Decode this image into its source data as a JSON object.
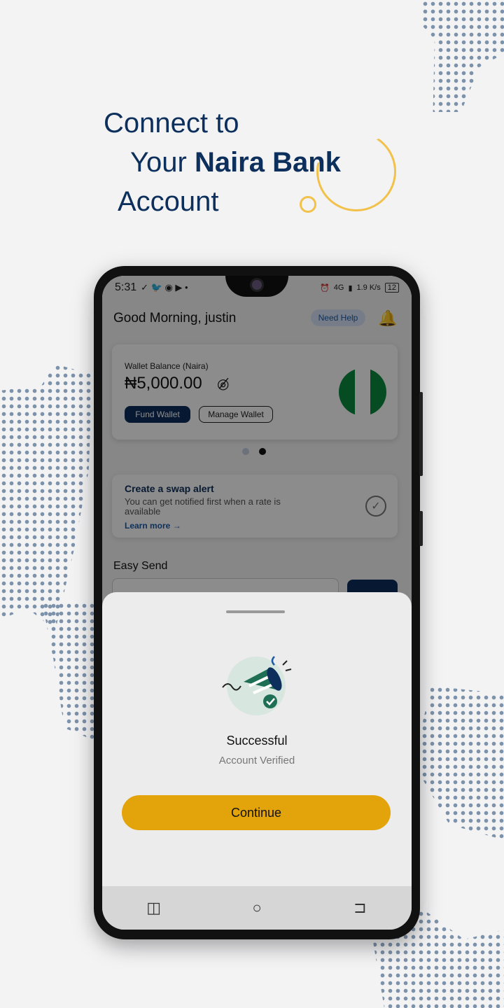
{
  "headline": {
    "line1": "Connect to",
    "line2_prefix": "Your ",
    "line2_bold": "Naira Bank",
    "line3": "Account",
    "accent_color": "#0d2f5b",
    "ring_color": "#f2c14a"
  },
  "status_bar": {
    "time": "5:31",
    "network": "4G",
    "speed": "1.9 K/s",
    "battery": "12"
  },
  "app": {
    "greeting": "Good Morning, justin",
    "help_label": "Need Help",
    "wallet": {
      "label": "Wallet Balance (Naira)",
      "amount": "₦5,000.00",
      "fund_label": "Fund Wallet",
      "manage_label": "Manage Wallet",
      "flag": "nigeria-flag-icon"
    },
    "pager": {
      "count": 2,
      "active": 2
    },
    "swap_alert": {
      "title": "Create a swap alert",
      "body": "You can get notified first when a rate is available",
      "link": "Learn more →"
    },
    "easy_send_label": "Easy Send"
  },
  "sheet": {
    "title": "Successful",
    "subtitle": "Account Verified",
    "continue_label": "Continue",
    "button_color": "#e2a30b"
  }
}
